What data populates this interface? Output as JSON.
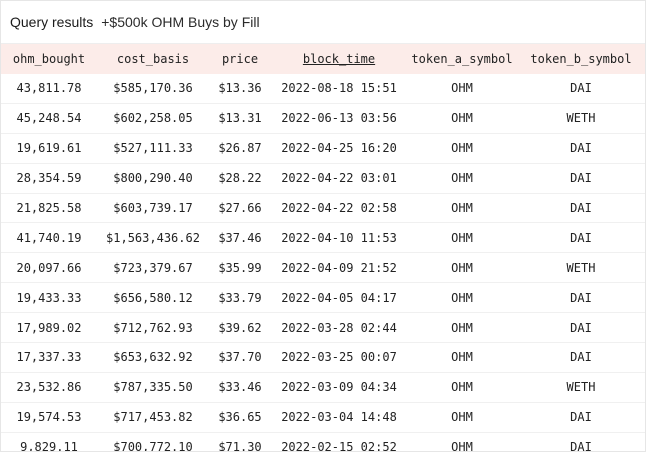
{
  "header": {
    "title": "Query results",
    "query_name": "+$500k OHM Buys by Fill"
  },
  "table": {
    "columns": [
      "ohm_bought",
      "cost_basis",
      "price",
      "block_time",
      "token_a_symbol",
      "token_b_symbol"
    ],
    "rows": [
      [
        "43,811.78",
        "$585,170.36",
        "$13.36",
        "2022-08-18 15:51",
        "OHM",
        "DAI"
      ],
      [
        "45,248.54",
        "$602,258.05",
        "$13.31",
        "2022-06-13 03:56",
        "OHM",
        "WETH"
      ],
      [
        "19,619.61",
        "$527,111.33",
        "$26.87",
        "2022-04-25 16:20",
        "OHM",
        "DAI"
      ],
      [
        "28,354.59",
        "$800,290.40",
        "$28.22",
        "2022-04-22 03:01",
        "OHM",
        "DAI"
      ],
      [
        "21,825.58",
        "$603,739.17",
        "$27.66",
        "2022-04-22 02:58",
        "OHM",
        "DAI"
      ],
      [
        "41,740.19",
        "$1,563,436.62",
        "$37.46",
        "2022-04-10 11:53",
        "OHM",
        "DAI"
      ],
      [
        "20,097.66",
        "$723,379.67",
        "$35.99",
        "2022-04-09 21:52",
        "OHM",
        "WETH"
      ],
      [
        "19,433.33",
        "$656,580.12",
        "$33.79",
        "2022-04-05 04:17",
        "OHM",
        "DAI"
      ],
      [
        "17,989.02",
        "$712,762.93",
        "$39.62",
        "2022-03-28 02:44",
        "OHM",
        "DAI"
      ],
      [
        "17,337.33",
        "$653,632.92",
        "$37.70",
        "2022-03-25 00:07",
        "OHM",
        "DAI"
      ],
      [
        "23,532.86",
        "$787,335.50",
        "$33.46",
        "2022-03-09 04:34",
        "OHM",
        "WETH"
      ],
      [
        "19,574.53",
        "$717,453.82",
        "$36.65",
        "2022-03-04 14:48",
        "OHM",
        "DAI"
      ],
      [
        "9,829.11",
        "$700,772.10",
        "$71.30",
        "2022-02-15 02:52",
        "OHM",
        "DAI"
      ]
    ]
  },
  "colors": {
    "header_row_bg": "#fcece9",
    "row_divider": "#f0f0f0"
  }
}
